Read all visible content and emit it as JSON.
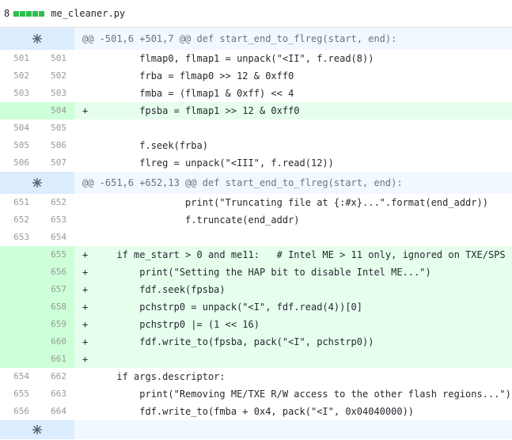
{
  "file": {
    "change_count": "8",
    "name": "me_cleaner.py"
  },
  "colors": {
    "addition_block": "#2cbe4e",
    "hunk_bg": "#f1f8ff",
    "add_bg": "#e6ffed",
    "add_gutter_bg": "#cdffd8"
  },
  "hunks": [
    {
      "header": "@@ -501,6 +501,7 @@ def start_end_to_flreg(start, end):",
      "lines": [
        {
          "old": "501",
          "new": "501",
          "type": "ctx",
          "code": "        flmap0, flmap1 = unpack(\"<II\", f.read(8))"
        },
        {
          "old": "502",
          "new": "502",
          "type": "ctx",
          "code": "        frba = flmap0 >> 12 & 0xff0"
        },
        {
          "old": "503",
          "new": "503",
          "type": "ctx",
          "code": "        fmba = (flmap1 & 0xff) << 4"
        },
        {
          "old": "",
          "new": "504",
          "type": "add",
          "code": "        fpsba = flmap1 >> 12 & 0xff0"
        },
        {
          "old": "504",
          "new": "505",
          "type": "ctx",
          "code": ""
        },
        {
          "old": "505",
          "new": "506",
          "type": "ctx",
          "code": "        f.seek(frba)"
        },
        {
          "old": "506",
          "new": "507",
          "type": "ctx",
          "code": "        flreg = unpack(\"<III\", f.read(12))"
        }
      ]
    },
    {
      "header": "@@ -651,6 +652,13 @@ def start_end_to_flreg(start, end):",
      "lines": [
        {
          "old": "651",
          "new": "652",
          "type": "ctx",
          "code": "                print(\"Truncating file at {:#x}...\".format(end_addr))"
        },
        {
          "old": "652",
          "new": "653",
          "type": "ctx",
          "code": "                f.truncate(end_addr)"
        },
        {
          "old": "653",
          "new": "654",
          "type": "ctx",
          "code": ""
        },
        {
          "old": "",
          "new": "655",
          "type": "add",
          "code": "    if me_start > 0 and me11:   # Intel ME > 11 only, ignored on TXE/SPS"
        },
        {
          "old": "",
          "new": "656",
          "type": "add",
          "code": "        print(\"Setting the HAP bit to disable Intel ME...\")"
        },
        {
          "old": "",
          "new": "657",
          "type": "add",
          "code": "        fdf.seek(fpsba)"
        },
        {
          "old": "",
          "new": "658",
          "type": "add",
          "code": "        pchstrp0 = unpack(\"<I\", fdf.read(4))[0]"
        },
        {
          "old": "",
          "new": "659",
          "type": "add",
          "code": "        pchstrp0 |= (1 << 16)"
        },
        {
          "old": "",
          "new": "660",
          "type": "add",
          "code": "        fdf.write_to(fpsba, pack(\"<I\", pchstrp0))"
        },
        {
          "old": "",
          "new": "661",
          "type": "add",
          "code": ""
        },
        {
          "old": "654",
          "new": "662",
          "type": "ctx",
          "code": "    if args.descriptor:"
        },
        {
          "old": "655",
          "new": "663",
          "type": "ctx",
          "code": "        print(\"Removing ME/TXE R/W access to the other flash regions...\")"
        },
        {
          "old": "656",
          "new": "664",
          "type": "ctx",
          "code": "        fdf.write_to(fmba + 0x4, pack(\"<I\", 0x04040000))"
        }
      ]
    }
  ]
}
